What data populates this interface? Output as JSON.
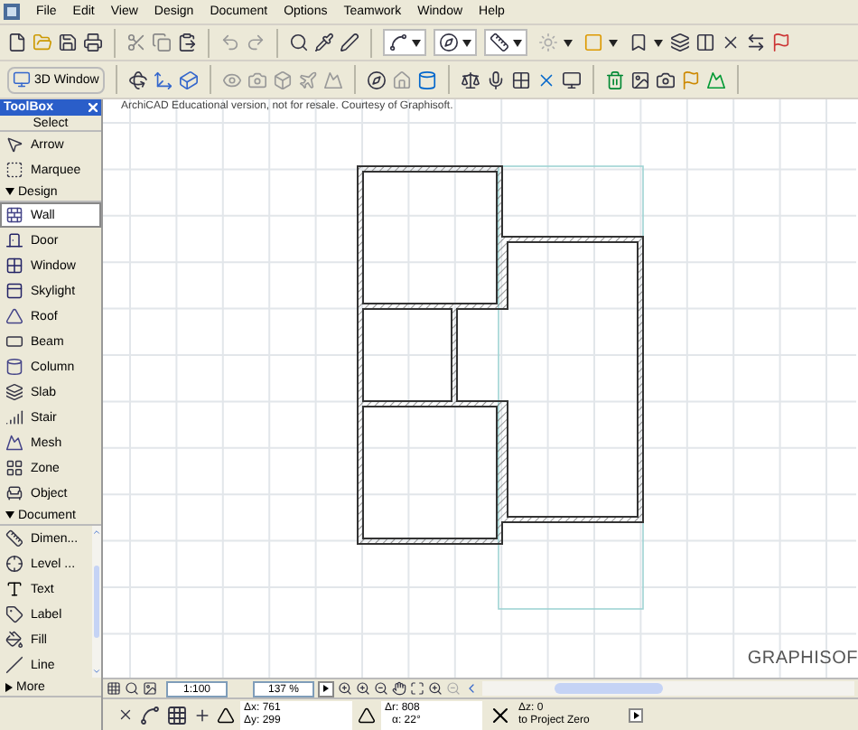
{
  "menu": [
    "File",
    "Edit",
    "View",
    "Design",
    "Document",
    "Options",
    "Teamwork",
    "Window",
    "Help"
  ],
  "toolbar": {
    "window_button": "3D Window"
  },
  "toolbox": {
    "title": "ToolBox",
    "sections": [
      {
        "kind": "plain",
        "title": "Select",
        "items": [
          {
            "label": "Arrow",
            "selected": false
          },
          {
            "label": "Marquee",
            "selected": false
          }
        ]
      },
      {
        "kind": "collapsible",
        "title": "Design",
        "expanded": true,
        "items": [
          {
            "label": "Wall",
            "selected": true
          },
          {
            "label": "Door",
            "selected": false
          },
          {
            "label": "Window",
            "selected": false
          },
          {
            "label": "Skylight",
            "selected": false
          },
          {
            "label": "Roof",
            "selected": false
          },
          {
            "label": "Beam",
            "selected": false
          },
          {
            "label": "Column",
            "selected": false
          },
          {
            "label": "Slab",
            "selected": false
          },
          {
            "label": "Stair",
            "selected": false
          },
          {
            "label": "Mesh",
            "selected": false
          },
          {
            "label": "Zone",
            "selected": false
          },
          {
            "label": "Object",
            "selected": false
          }
        ]
      },
      {
        "kind": "collapsible",
        "title": "Document",
        "expanded": true,
        "items": [
          {
            "label": "Dimen...",
            "selected": false
          },
          {
            "label": "Level ...",
            "selected": false
          },
          {
            "label": "Text",
            "selected": false
          },
          {
            "label": "Label",
            "selected": false
          },
          {
            "label": "Fill",
            "selected": false
          },
          {
            "label": "Line",
            "selected": false
          }
        ]
      },
      {
        "kind": "collapsible",
        "title": "More",
        "expanded": false
      }
    ]
  },
  "canvas": {
    "notice": "ArchiCAD Educational version, not for resale. Courtesy of Graphisoft.",
    "watermark": "GRAPHISOF"
  },
  "view_controls": {
    "scale": "1:100",
    "zoom": "137 %"
  },
  "status_bar": {
    "dx": "Δx: 761",
    "dy": "Δy: 299",
    "dr": "Δr: 808",
    "angle": "α: 22°",
    "dz": "Δz: 0",
    "reference": "to Project Zero"
  }
}
